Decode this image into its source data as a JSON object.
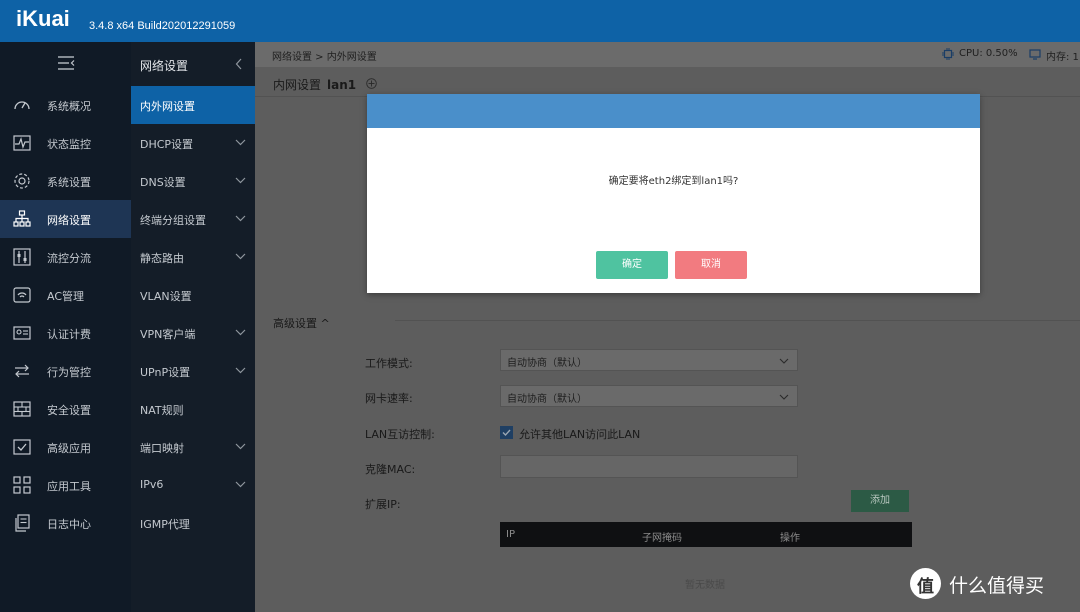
{
  "header": {
    "logo": "iKuai",
    "version": "3.4.8 x64 Build202012291059"
  },
  "sidebar": {
    "items": [
      {
        "label": "系统概况",
        "icon": "dashboard-icon"
      },
      {
        "label": "状态监控",
        "icon": "monitor-icon"
      },
      {
        "label": "系统设置",
        "icon": "gear-icon"
      },
      {
        "label": "网络设置",
        "icon": "network-icon",
        "active": true
      },
      {
        "label": "流控分流",
        "icon": "sliders-icon"
      },
      {
        "label": "AC管理",
        "icon": "wifi-icon"
      },
      {
        "label": "认证计费",
        "icon": "id-card-icon"
      },
      {
        "label": "行为管控",
        "icon": "arrows-icon"
      },
      {
        "label": "安全设置",
        "icon": "firewall-icon"
      },
      {
        "label": "高级应用",
        "icon": "check-box-icon"
      },
      {
        "label": "应用工具",
        "icon": "grid-icon"
      },
      {
        "label": "日志中心",
        "icon": "document-icon"
      }
    ]
  },
  "submenu": {
    "title": "网络设置",
    "items": [
      {
        "label": "内外网设置",
        "active": true,
        "chevron": false
      },
      {
        "label": "DHCP设置",
        "chevron": true
      },
      {
        "label": "DNS设置",
        "chevron": true
      },
      {
        "label": "终端分组设置",
        "chevron": true
      },
      {
        "label": "静态路由",
        "chevron": true
      },
      {
        "label": "VLAN设置",
        "chevron": false
      },
      {
        "label": "VPN客户端",
        "chevron": true
      },
      {
        "label": "UPnP设置",
        "chevron": true
      },
      {
        "label": "NAT规则",
        "chevron": false
      },
      {
        "label": "端口映射",
        "chevron": true
      },
      {
        "label": "IPv6",
        "chevron": true
      },
      {
        "label": "IGMP代理",
        "chevron": false
      }
    ]
  },
  "breadcrumb": "网络设置 > 内外网设置",
  "status": {
    "cpu": "CPU: 0.50%",
    "mem": "内存: 1"
  },
  "page": {
    "title": "内网设置",
    "interface": "lan1"
  },
  "advanced": {
    "section_label": "高级设置",
    "work_mode_label": "工作模式:",
    "work_mode_value": "自动协商（默认）",
    "nic_speed_label": "网卡速率:",
    "nic_speed_value": "自动协商（默认）",
    "lan_access_label": "LAN互访控制:",
    "lan_access_checkbox": "允许其他LAN访问此LAN",
    "lan_access_checked": true,
    "clone_mac_label": "克隆MAC:",
    "clone_mac_value": "",
    "ext_ip_label": "扩展IP:",
    "add_button": "添加",
    "table_columns": [
      "IP",
      "子网掩码",
      "操作"
    ],
    "empty_text": "暂无数据"
  },
  "dialog": {
    "message": "确定要将eth2绑定到lan1吗?",
    "confirm": "确定",
    "cancel": "取消"
  },
  "watermark": {
    "badge": "值",
    "text": "什么值得买"
  },
  "colors": {
    "header": "#0e62a6",
    "sidebar": "#101a26",
    "submenu_active": "#0e62a6",
    "dialog_header": "#4a8fca",
    "confirm": "#4fc3a0",
    "cancel": "#f27b80"
  }
}
